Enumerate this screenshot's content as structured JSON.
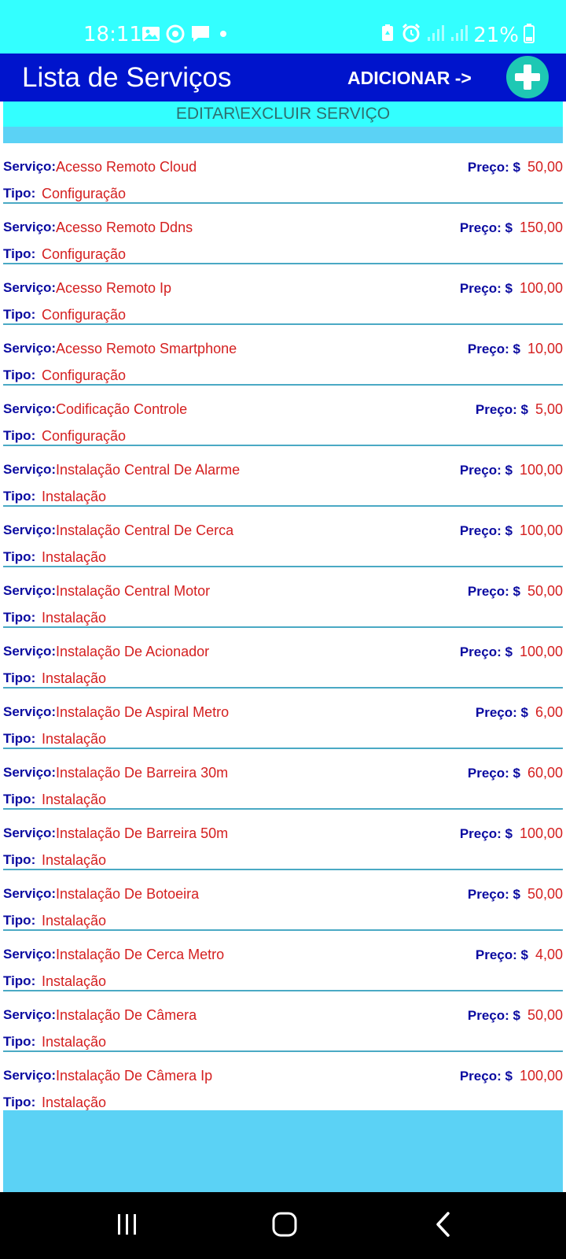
{
  "status_bar": {
    "time": "18:11",
    "battery": "21%",
    "left_icons": [
      "gallery-icon",
      "sync-icon",
      "message-icon",
      "dot-icon"
    ],
    "right_icons": [
      "battery-saver-icon",
      "alarm-icon",
      "signal-icon",
      "signal-icon-2",
      "battery-icon"
    ]
  },
  "app_bar": {
    "title": "Lista de Serviços",
    "add_label": "ADICIONAR ->",
    "add_icon": "plus-icon"
  },
  "sub_header": {
    "label": "EDITAR\\EXCLUIR SERVIÇO"
  },
  "labels": {
    "service": "Serviço:",
    "price": "Preço: $",
    "type": "Tipo:"
  },
  "services": [
    {
      "name": "Acesso Remoto Cloud",
      "price": "50,00",
      "type": "Configuração"
    },
    {
      "name": "Acesso Remoto Ddns",
      "price": "150,00",
      "type": "Configuração"
    },
    {
      "name": "Acesso Remoto Ip",
      "price": "100,00",
      "type": "Configuração"
    },
    {
      "name": "Acesso Remoto Smartphone",
      "price": "10,00",
      "type": "Configuração"
    },
    {
      "name": "Codificação Controle",
      "price": "5,00",
      "type": "Configuração"
    },
    {
      "name": "Instalação Central De Alarme",
      "price": "100,00",
      "type": "Instalação"
    },
    {
      "name": "Instalação Central De Cerca",
      "price": "100,00",
      "type": "Instalação"
    },
    {
      "name": "Instalação Central Motor",
      "price": "50,00",
      "type": "Instalação"
    },
    {
      "name": "Instalação De Acionador",
      "price": "100,00",
      "type": "Instalação"
    },
    {
      "name": "Instalação De Aspiral Metro",
      "price": "6,00",
      "type": "Instalação"
    },
    {
      "name": "Instalação De Barreira 30m",
      "price": "60,00",
      "type": "Instalação"
    },
    {
      "name": "Instalação De Barreira 50m",
      "price": "100,00",
      "type": "Instalação"
    },
    {
      "name": "Instalação De Botoeira",
      "price": "50,00",
      "type": "Instalação"
    },
    {
      "name": "Instalação De Cerca Metro",
      "price": "4,00",
      "type": "Instalação"
    },
    {
      "name": "Instalação De Câmera",
      "price": "50,00",
      "type": "Instalação"
    },
    {
      "name": "Instalação De Câmera Ip",
      "price": "100,00",
      "type": "Instalação"
    }
  ],
  "nav_bar": {
    "icons": [
      "recent-apps-icon",
      "home-icon",
      "back-icon"
    ]
  },
  "colors": {
    "status_bar_bg": "#33ffff",
    "app_bar_bg": "#0014cc",
    "fab_bg": "#1ec8b4",
    "panel_bg": "#5bd2f5",
    "label_color": "#0a0aa0",
    "value_color": "#d42020",
    "divider_color": "#4aa9c4"
  }
}
